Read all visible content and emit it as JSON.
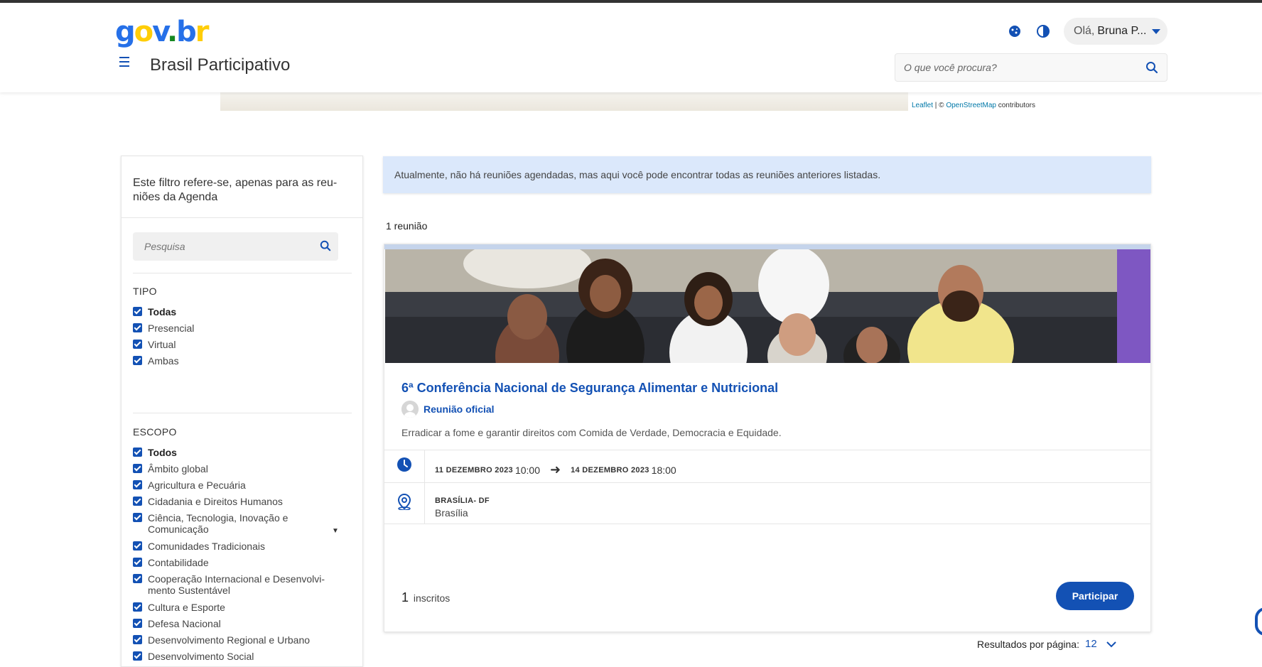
{
  "header": {
    "logo_text": "gov.br",
    "site_title": "Brasil Participativo",
    "user": {
      "greeting": "Olá,",
      "name": "Bruna P..."
    },
    "search_placeholder": "O que você procura?",
    "icons": [
      "menu-icon",
      "cookie-icon",
      "contrast-icon",
      "search-icon"
    ]
  },
  "map": {
    "attribution_leaflet": "Leaflet",
    "attribution_sep": " | © ",
    "attribution_osm": "OpenStreetMap",
    "attribution_suffix": " contributors"
  },
  "filters": {
    "note": "Este filtro refere-se, apenas para as reu-niões da Agenda",
    "search_placeholder": "Pesquisa",
    "tipo": {
      "title": "TIPO",
      "items": [
        "Todas",
        "Presencial",
        "Virtual",
        "Ambas"
      ]
    },
    "escopo": {
      "title": "ESCOPO",
      "items": [
        "Todos",
        "Âmbito global",
        "Agricultura e Pecuária",
        "Cidadania e Direitos Humanos",
        "Ciência, Tecnologia, Inovação e Comunicação",
        "Comunidades Tradicionais",
        "Contabilidade",
        "Cooperação Internacional e Desenvolvi-mento Sustentável",
        "Cultura e Esporte",
        "Defesa Nacional",
        "Desenvolvimento Regional e Urbano",
        "Desenvolvimento Social"
      ]
    }
  },
  "notice": "Atualmente, não há reuniões agendadas, mas aqui você pode encontrar todas as reuniões anteriores listadas.",
  "results_count": "1 reunião",
  "meeting": {
    "title": "6ª Conferência Nacional de Segurança Alimentar e Nutricional",
    "organizer": "Reunião oficial",
    "description": "Erradicar a fome e garantir direitos com Comida de Verdade, Democracia e Equidade.",
    "start_date": "11 DEZEMBRO 2023",
    "start_time": "10:00",
    "end_date": "14 DEZEMBRO 2023",
    "end_time": "18:00",
    "location_state": "BRASÍLIA- DF",
    "location_city": "Brasília",
    "enrolled_count": "1",
    "enrolled_label": "inscritos",
    "join_label": "Participar"
  },
  "pagination": {
    "label": "Resultados por página:",
    "value": "12"
  },
  "colors": {
    "primary": "#1351b4",
    "notice_bg": "#dbe8fb"
  }
}
